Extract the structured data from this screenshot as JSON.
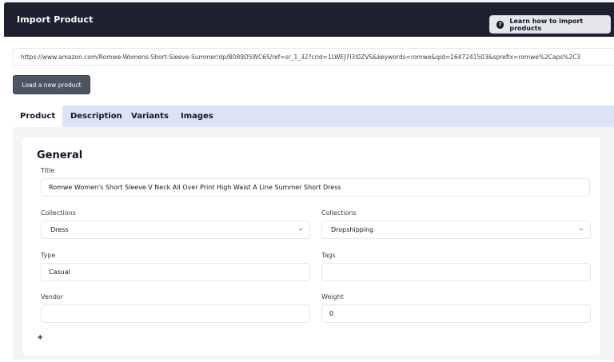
{
  "header": {
    "title": "Import Product",
    "learn_button": "Learn how to import products",
    "help_icon": "?"
  },
  "url_input": {
    "value": "https://www.amazon.com/Romwe-Womens-Short-Sleeve-Summer/dp/B089D5WC6S/ref=sr_1_32?crid=1LWEJ7I3I0ZVS&keywords=romwe&qid=1647241503&sprefix=romwe%2Caps%2C3"
  },
  "load_button": "Load a new product",
  "tabs": [
    {
      "label": "Product"
    },
    {
      "label": "Description"
    },
    {
      "label": "Variants"
    },
    {
      "label": "Images"
    }
  ],
  "general": {
    "heading": "General",
    "title_label": "Title",
    "title_value": "Romwe Women's Short Sleeve V Neck All Over Print High Waist A Line Summer Short Dress",
    "collections_label_1": "Collections",
    "collections_value_1": "Dress",
    "collections_label_2": "Collections",
    "collections_value_2": "Dropshipping",
    "type_label": "Type",
    "type_value": "Casual",
    "tags_label": "Tags",
    "tags_value": "",
    "vendor_label": "Vendor",
    "vendor_value": "",
    "weight_label": "Weight",
    "weight_value": "0",
    "add_label": "+"
  }
}
